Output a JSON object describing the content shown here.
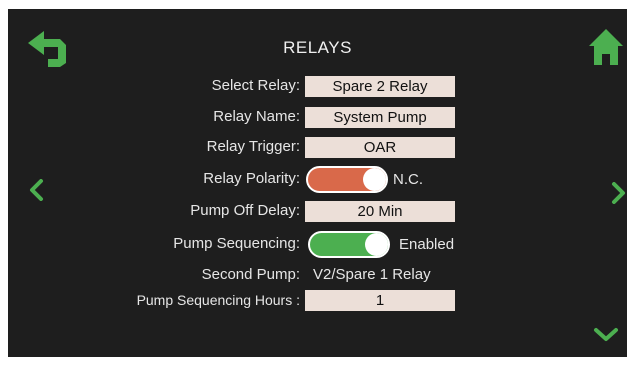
{
  "colors": {
    "background": "#1e1e1e",
    "accent_green": "#4caf50",
    "polarity_toggle": "#d9694a",
    "sequencing_toggle": "#4caf50",
    "field_bg": "#ecdfd8"
  },
  "header": {
    "title": "RELAYS",
    "back_icon": "back-arrow-icon",
    "home_icon": "home-icon"
  },
  "nav": {
    "prev_icon": "chevron-left-icon",
    "next_icon": "chevron-right-icon",
    "down_icon": "chevron-down-icon"
  },
  "form": {
    "select_relay": {
      "label": "Select Relay:",
      "value": "Spare 2 Relay"
    },
    "relay_name": {
      "label": "Relay Name:",
      "value": "System Pump"
    },
    "relay_trigger": {
      "label": "Relay Trigger:",
      "value": "OAR"
    },
    "relay_polarity": {
      "label": "Relay Polarity:",
      "state_text": "N.C."
    },
    "pump_off_delay": {
      "label": "Pump Off Delay:",
      "value": "20 Min"
    },
    "pump_sequencing": {
      "label": "Pump Sequencing:",
      "state_text": "Enabled"
    },
    "second_pump": {
      "label": "Second Pump:",
      "value": "V2/Spare 1 Relay"
    },
    "pump_sequencing_hours": {
      "label": "Pump Sequencing Hours :",
      "value": "1"
    }
  }
}
